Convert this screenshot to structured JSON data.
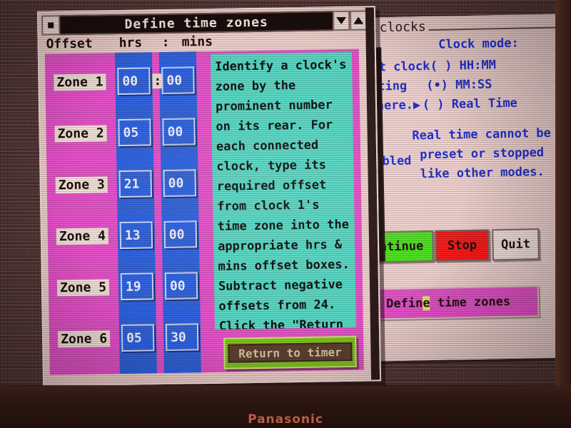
{
  "desktop": {
    "monitor_brand": "Panasonic"
  },
  "dialog": {
    "title": "Define time zones",
    "window_controls": {
      "menu_box": "menu-box",
      "down_arrow": "▼",
      "up_arrow": "▲"
    },
    "headers": {
      "offset": "Offset",
      "hrs": "hrs",
      "colon": ":",
      "mins": "mins"
    },
    "zones": [
      {
        "label": "Zone 1",
        "hrs": "00",
        "mins": "00"
      },
      {
        "label": "Zone 2",
        "hrs": "05",
        "mins": "00"
      },
      {
        "label": "Zone 3",
        "hrs": "21",
        "mins": "00"
      },
      {
        "label": "Zone 4",
        "hrs": "13",
        "mins": "00"
      },
      {
        "label": "Zone 5",
        "hrs": "19",
        "mins": "00"
      },
      {
        "label": "Zone 6",
        "hrs": "05",
        "mins": "30"
      }
    ],
    "instructions": "Identify a clock's zone by the prominent number on its rear. For each connected clock, type its required offset from clock 1's time zone into the appropriate hrs & mins offset boxes. Subtract negative offsets from 24. Click the \"Return to timer\" button when done.",
    "return_button": "Return to timer",
    "colors": {
      "window_face": "#edcfcb",
      "content_magenta": "#e452c8",
      "field_blue": "#2f62dc",
      "instruction_teal": "#57d6c2",
      "return_green": "#7fc120"
    }
  },
  "clocks_window": {
    "title": "clocks",
    "clock_mode_heading": "Clock mode:",
    "modes": [
      {
        "marker": "( )",
        "label": "HH:MM",
        "selected": false
      },
      {
        "marker": "(•)",
        "label": "MM:SS",
        "selected": true
      },
      {
        "marker": "( )",
        "label": "Real Time",
        "selected": false
      }
    ],
    "occluded_text": {
      "line1": "t clock",
      "line2": "ting",
      "line3": "here.▶",
      "line4": "abled"
    },
    "realtime_note": "Real time cannot be preset or stopped like other modes.",
    "buttons": {
      "continue": "ntinue",
      "stop": "Stop",
      "quit": "Quit"
    },
    "define_bar": {
      "prefix": "Defin",
      "highlight": "e",
      "suffix": " time zones"
    },
    "colors": {
      "window_face": "#efd2cf",
      "text_blue": "#2431cf",
      "continue_green": "#4ee022",
      "stop_red": "#f51c1c",
      "define_magenta": "#e452c8",
      "highlight_yellow": "#e6e86a"
    }
  }
}
